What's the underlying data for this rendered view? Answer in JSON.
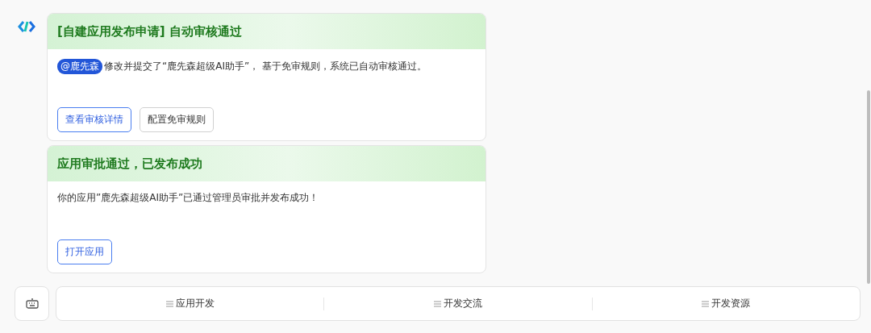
{
  "cards": [
    {
      "title": "[自建应用发布申请] 自动审核通过",
      "mention": "@鹿先森",
      "text": "修改并提交了“鹿先森超级AI助手”， 基于免审规则，系统已自动审核通过。",
      "buttons": [
        {
          "label": "查看审核详情",
          "kind": "primary"
        },
        {
          "label": "配置免审规则",
          "kind": "default"
        }
      ]
    },
    {
      "title": "应用审批通过，已发布成功",
      "text": "你的应用”鹿先森超级AI助手”已通过管理员审批并发布成功！",
      "buttons": [
        {
          "label": "打开应用",
          "kind": "primary"
        }
      ]
    }
  ],
  "menu": [
    "应用开发",
    "开发交流",
    "开发资源"
  ]
}
